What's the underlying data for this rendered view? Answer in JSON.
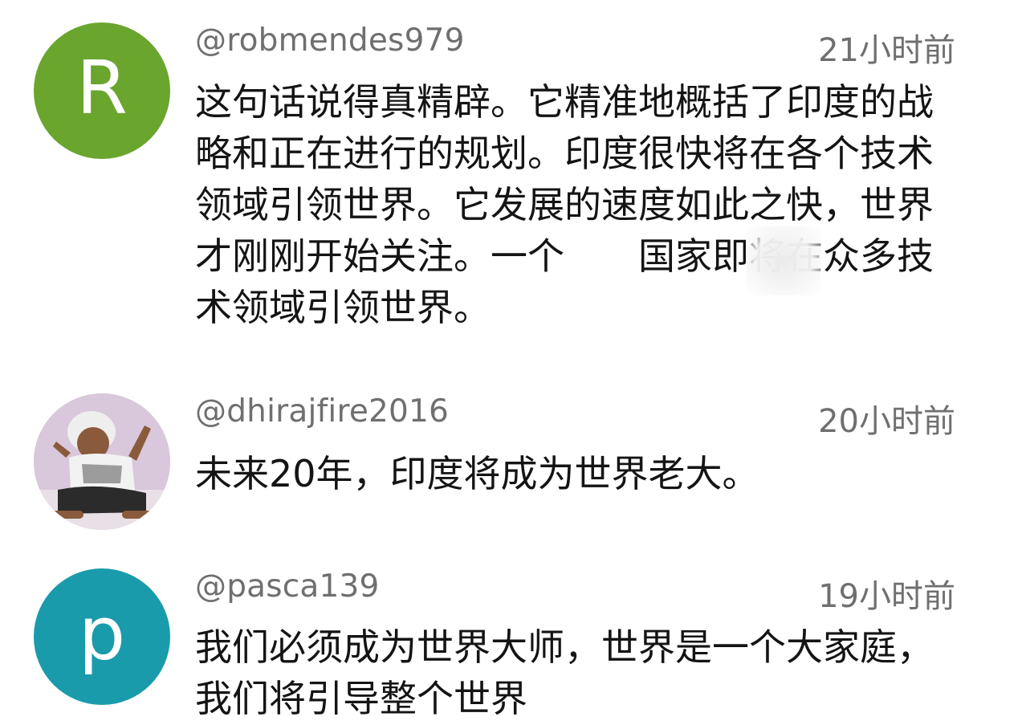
{
  "comments": [
    {
      "avatar_letter": "R",
      "avatar_color": "#6aa52e",
      "username": "@robmendes979",
      "time": "21小时前",
      "text": "这句话说得真精辟。它精准地概括了印度的战略和正在进行的规划。印度很快将在各个技术领域引领世界。它发展的速度如此之快，世界才刚刚开始关注。一个　　国家即将在众多技术领域引领世界。"
    },
    {
      "avatar_letter": "",
      "avatar_color": "#d8cbd8",
      "username": "@dhirajfire2016",
      "time": "20小时前",
      "text": "未来20年，印度将成为世界老大。"
    },
    {
      "avatar_letter": "p",
      "avatar_color": "#1a9bab",
      "username": "@pasca139",
      "time": "19小时前",
      "text": "我们必须成为世界大师，世界是一个大家庭，我们将引导整个世界"
    }
  ]
}
